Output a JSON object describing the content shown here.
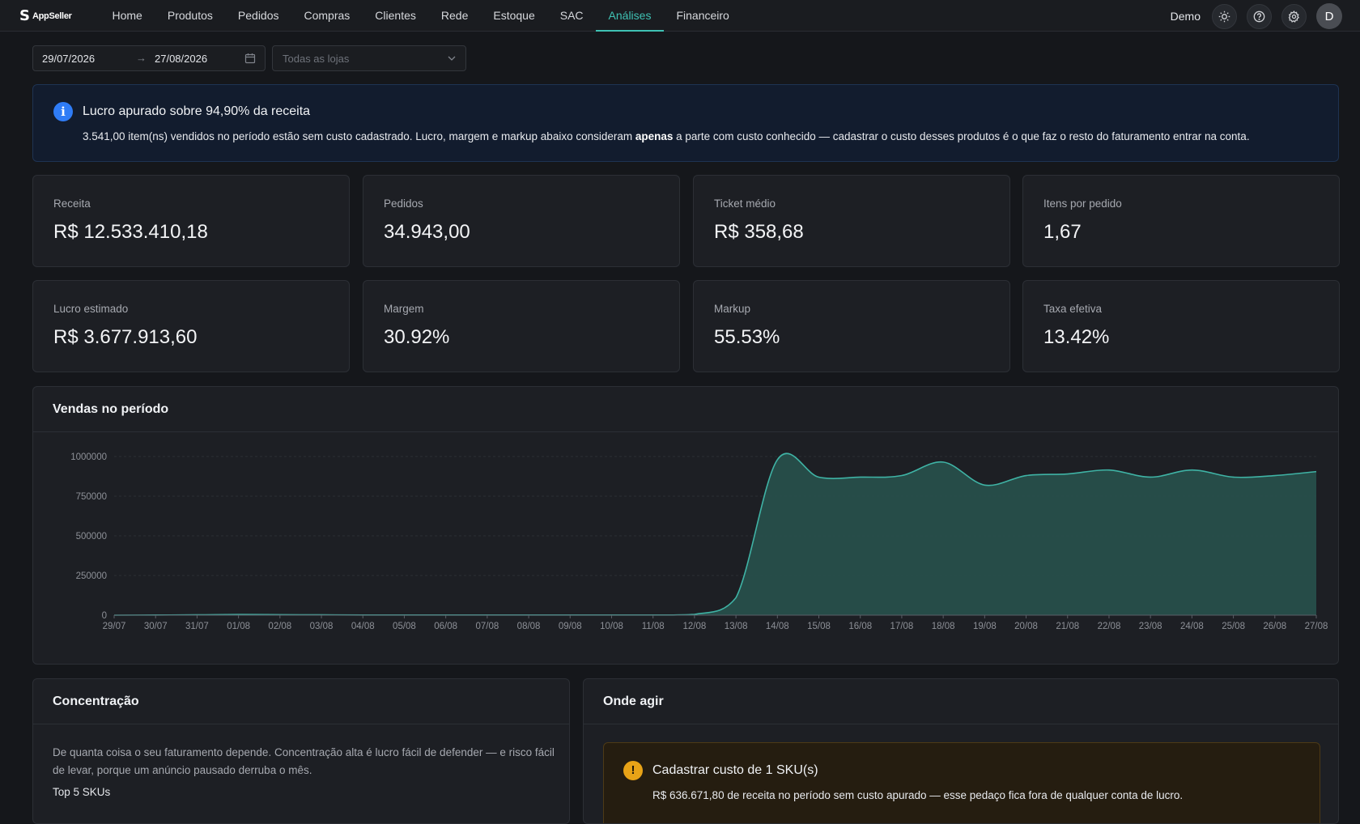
{
  "app": {
    "brand": "AppSeller"
  },
  "nav": {
    "items": [
      {
        "label": "Home"
      },
      {
        "label": "Produtos"
      },
      {
        "label": "Pedidos"
      },
      {
        "label": "Compras"
      },
      {
        "label": "Clientes"
      },
      {
        "label": "Rede"
      },
      {
        "label": "Estoque"
      },
      {
        "label": "SAC"
      },
      {
        "label": "Análises",
        "active": true
      },
      {
        "label": "Financeiro"
      }
    ],
    "user": "Demo",
    "avatar_initial": "D"
  },
  "filters": {
    "date_start": "29/07/2026",
    "date_end": "27/08/2026",
    "store_placeholder": "Todas as lojas"
  },
  "alert": {
    "title": "Lucro apurado sobre 94,90% da receita",
    "body_before": "3.541,00 item(ns) vendidos no período estão sem custo cadastrado. Lucro, margem e markup abaixo consideram ",
    "body_bold": "apenas",
    "body_after": " a parte com custo conhecido — cadastrar o custo desses produtos é o que faz o resto do faturamento entrar na conta."
  },
  "kpis": [
    {
      "label": "Receita",
      "value": "R$ 12.533.410,18"
    },
    {
      "label": "Pedidos",
      "value": "34.943,00"
    },
    {
      "label": "Ticket médio",
      "value": "R$ 358,68"
    },
    {
      "label": "Itens por pedido",
      "value": "1,67"
    },
    {
      "label": "Lucro estimado",
      "value": "R$ 3.677.913,60"
    },
    {
      "label": "Margem",
      "value": "30.92%"
    },
    {
      "label": "Markup",
      "value": "55.53%"
    },
    {
      "label": "Taxa efetiva",
      "value": "13.42%"
    }
  ],
  "sales_chart": {
    "title": "Vendas no período"
  },
  "chart_data": {
    "type": "area",
    "title": "Vendas no período",
    "x": [
      "29/07",
      "30/07",
      "31/07",
      "01/08",
      "02/08",
      "03/08",
      "04/08",
      "05/08",
      "06/08",
      "07/08",
      "08/08",
      "09/08",
      "10/08",
      "11/08",
      "12/08",
      "13/08",
      "14/08",
      "15/08",
      "16/08",
      "17/08",
      "18/08",
      "19/08",
      "20/08",
      "21/08",
      "22/08",
      "23/08",
      "24/08",
      "25/08",
      "26/08",
      "27/08"
    ],
    "series": [
      {
        "values": [
          0,
          1000,
          2000,
          4000,
          3000,
          2000,
          1000,
          1000,
          1000,
          1000,
          1000,
          1000,
          1000,
          1000,
          5000,
          110000,
          980000,
          870000,
          870000,
          880000,
          965000,
          820000,
          880000,
          890000,
          915000,
          870000,
          915000,
          870000,
          880000,
          905000
        ]
      }
    ],
    "yticks": [
      0,
      250000,
      500000,
      750000,
      1000000
    ],
    "ylim": [
      0,
      1000000
    ],
    "grid": true,
    "colors": {
      "line": "#3fb3a5",
      "fill": "#28514c"
    }
  },
  "concentration": {
    "title": "Concentração",
    "description": "De quanta coisa o seu faturamento depende. Concentração alta é lucro fácil de defender — e risco fácil de levar, porque um anúncio pausado derruba o mês.",
    "subtitle": "Top 5 SKUs"
  },
  "actions": {
    "title": "Onde agir",
    "warning_title": "Cadastrar custo de 1 SKU(s)",
    "warning_body": "R$ 636.671,80 de receita no período sem custo apurado — esse pedaço fica fora de qualquer conta de lucro."
  }
}
